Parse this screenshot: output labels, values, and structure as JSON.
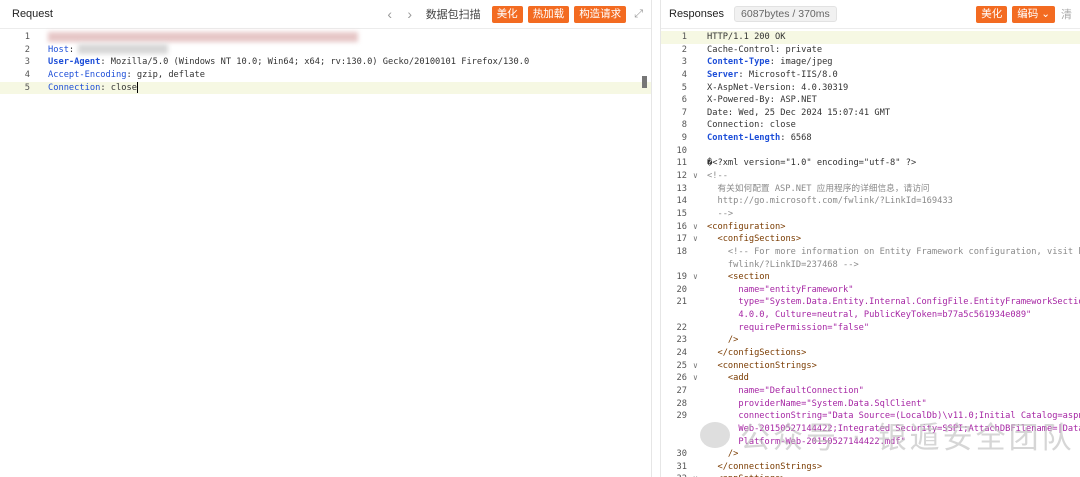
{
  "left": {
    "title": "Request",
    "actions": {
      "scan": "数据包扫描",
      "beautify": "美化",
      "hot": "热加载",
      "construct": "构造请求"
    },
    "lines": [
      {
        "n": "1",
        "k": "",
        "v": ""
      },
      {
        "n": "2",
        "k": "Host",
        "v": ""
      },
      {
        "n": "3",
        "k": "User-Agent",
        "v": " Mozilla/5.0 (Windows NT 10.0; Win64; x64; rv:130.0) Gecko/20100101 Firefox/130.0"
      },
      {
        "n": "4",
        "k": "Accept-Encoding",
        "v": " gzip, deflate"
      },
      {
        "n": "5",
        "k": "Connection",
        "v": " close"
      }
    ]
  },
  "right": {
    "title": "Responses",
    "size": "6087bytes / 370ms",
    "actions": {
      "beautify": "美化",
      "encoding": "编码",
      "clear": "清"
    },
    "lines": [
      {
        "n": "1",
        "t": "HTTP/1.1 200 OK"
      },
      {
        "n": "2",
        "t": "Cache-Control: private"
      },
      {
        "n": "3",
        "k": "Content-Type",
        "v": " image/jpeg"
      },
      {
        "n": "4",
        "k": "Server",
        "v": " Microsoft-IIS/8.0"
      },
      {
        "n": "5",
        "t": "X-AspNet-Version: 4.0.30319"
      },
      {
        "n": "6",
        "t": "X-Powered-By: ASP.NET"
      },
      {
        "n": "7",
        "t": "Date: Wed, 25 Dec 2024 15:07:41 GMT"
      },
      {
        "n": "8",
        "t": "Connection: close"
      },
      {
        "n": "9",
        "k": "Content-Length",
        "v": " 6568"
      },
      {
        "n": "10",
        "t": ""
      },
      {
        "n": "11",
        "t": "�<?xml version=\"1.0\" encoding=\"utf-8\" ?>"
      },
      {
        "n": "12",
        "t": "<!--",
        "c": true
      },
      {
        "n": "13",
        "t": "  有关如何配置 ASP.NET 应用程序的详细信息，请访问",
        "c": true
      },
      {
        "n": "14",
        "t": "  http://go.microsoft.com/fwlink/?LinkId=169433",
        "c": true
      },
      {
        "n": "15",
        "t": "  -->",
        "c": true
      },
      {
        "n": "16",
        "t": "<configuration>",
        "g": true
      },
      {
        "n": "17",
        "t": "  <configSections>",
        "g": true
      },
      {
        "n": "18",
        "t": "    <!-- For more information on Entity Framework configuration, visit h",
        "c": true
      },
      {
        "n": "",
        "t": "    fwlink/?LinkID=237468 -->",
        "c": true
      },
      {
        "n": "19",
        "t": "    <section",
        "g": true
      },
      {
        "n": "20",
        "t": "      name=\"entityFramework\"",
        "a": true
      },
      {
        "n": "21",
        "t": "      type=\"System.Data.Entity.Internal.ConfigFile.EntityFrameworkSectio",
        "a": true
      },
      {
        "n": "",
        "t": "      4.0.0, Culture=neutral, PublicKeyToken=b77a5c561934e089\"",
        "a": true
      },
      {
        "n": "22",
        "t": "      requirePermission=\"false\"",
        "a": true
      },
      {
        "n": "23",
        "t": "    />",
        "g": true
      },
      {
        "n": "24",
        "t": "  </configSections>",
        "g": true
      },
      {
        "n": "25",
        "t": "  <connectionStrings>",
        "g": true
      },
      {
        "n": "26",
        "t": "    <add",
        "g": true
      },
      {
        "n": "27",
        "t": "      name=\"DefaultConnection\"",
        "a": true
      },
      {
        "n": "28",
        "t": "      providerName=\"System.Data.SqlClient\"",
        "a": true
      },
      {
        "n": "29",
        "t": "      connectionString=\"Data Source=(LocalDb)\\v11.0;Initial Catalog=aspn",
        "a": true
      },
      {
        "n": "",
        "t": "      Web-20150527144422;Integrated Security=SSPI;AttachDBFilename=|Data",
        "a": true
      },
      {
        "n": "",
        "t": "      Platform-Web-20150527144422.mdf\"",
        "a": true
      },
      {
        "n": "30",
        "t": "    />",
        "g": true
      },
      {
        "n": "31",
        "t": "  </connectionStrings>",
        "g": true
      },
      {
        "n": "32",
        "t": "  <appSettings>",
        "g": true
      }
    ]
  },
  "watermark": "公众号 · 银遁安全团队"
}
